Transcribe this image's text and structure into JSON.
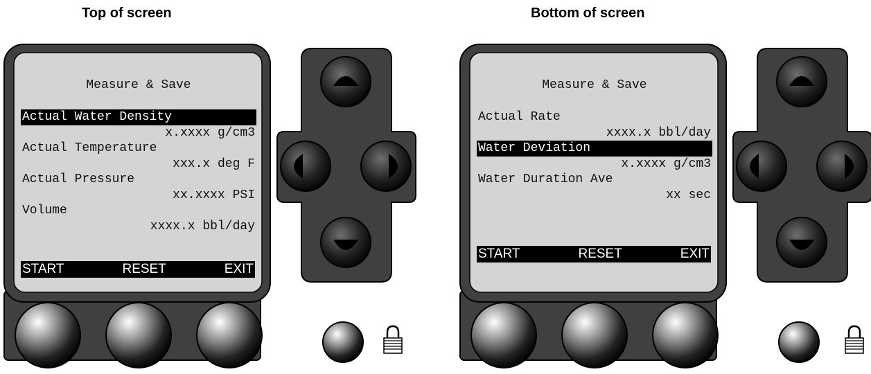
{
  "panels": [
    {
      "caption": "Top of screen",
      "screen_title": "Measure & Save",
      "rows": [
        {
          "label": "Actual Water Density",
          "value": "x.xxxx g/cm3",
          "selected": true
        },
        {
          "label": "Actual Temperature",
          "value": "xxx.x deg F",
          "selected": false
        },
        {
          "label": "Actual Pressure",
          "value": "xx.xxxx PSI",
          "selected": false
        },
        {
          "label": "Volume",
          "value": "xxxx.x bbl/day",
          "selected": false
        }
      ],
      "softkeys": {
        "start": "START",
        "reset": "RESET",
        "exit": "EXIT"
      }
    },
    {
      "caption": "Bottom of screen",
      "screen_title": "Measure & Save",
      "rows": [
        {
          "label": "Actual Rate",
          "value": "xxxx.x bbl/day",
          "selected": false
        },
        {
          "label": "Water Deviation",
          "value": "x.xxxx g/cm3",
          "selected": true
        },
        {
          "label": "Water Duration Ave",
          "value": "xx sec",
          "selected": false
        }
      ],
      "softkeys": {
        "start": "START",
        "reset": "RESET",
        "exit": "EXIT"
      }
    }
  ],
  "icons": {
    "arrow_up": "arrow-up-icon",
    "arrow_down": "arrow-down-icon",
    "arrow_left": "arrow-left-icon",
    "arrow_right": "arrow-right-icon",
    "lock": "padlock-icon"
  },
  "colors": {
    "bezel": "#404040",
    "screen": "#d4d4d4",
    "highlight": "#000000",
    "button_dark": "#111111"
  }
}
